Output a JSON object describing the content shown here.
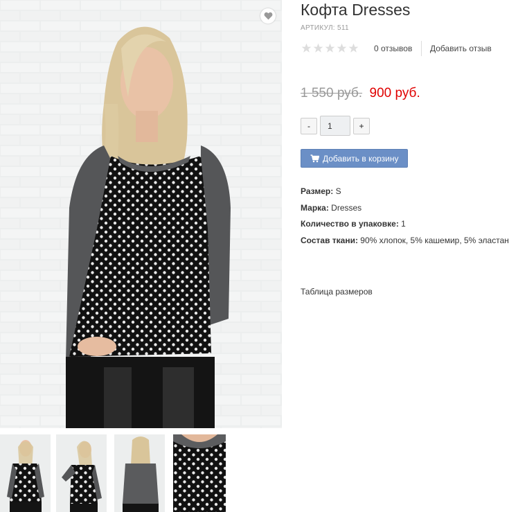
{
  "product": {
    "title": "Кофта Dresses",
    "sku": "АРТИКУЛ: 511",
    "rating": {
      "stars_filled": 0,
      "stars_total": 5
    },
    "reviews_count": "0 отзывов",
    "add_review": "Добавить отзыв",
    "old_price": "1 550 руб.",
    "new_price": "900 руб.",
    "quantity": {
      "minus": "-",
      "value": "1",
      "plus": "+"
    },
    "add_to_cart": "Добавить в корзину",
    "properties": [
      {
        "label": "Размер:",
        "value": "S"
      },
      {
        "label": "Марка:",
        "value": "Dresses"
      },
      {
        "label": "Количество в упаковке:",
        "value": "1"
      },
      {
        "label": "Состав ткани:",
        "value": "90% хлопок, 5% кашемир, 5% эластан"
      }
    ],
    "size_table_link": "Таблица размеров"
  },
  "icons": {
    "wishlist": "heart-icon",
    "cart": "cart-icon",
    "rating": "star-icon"
  },
  "colors": {
    "accent_button": "#6b8fc6",
    "sale_price": "#e00000",
    "old_price": "#999999",
    "star_empty": "#dddddd"
  },
  "gallery": {
    "thumbnails": [
      "front view",
      "side view",
      "back view",
      "fabric detail"
    ]
  }
}
